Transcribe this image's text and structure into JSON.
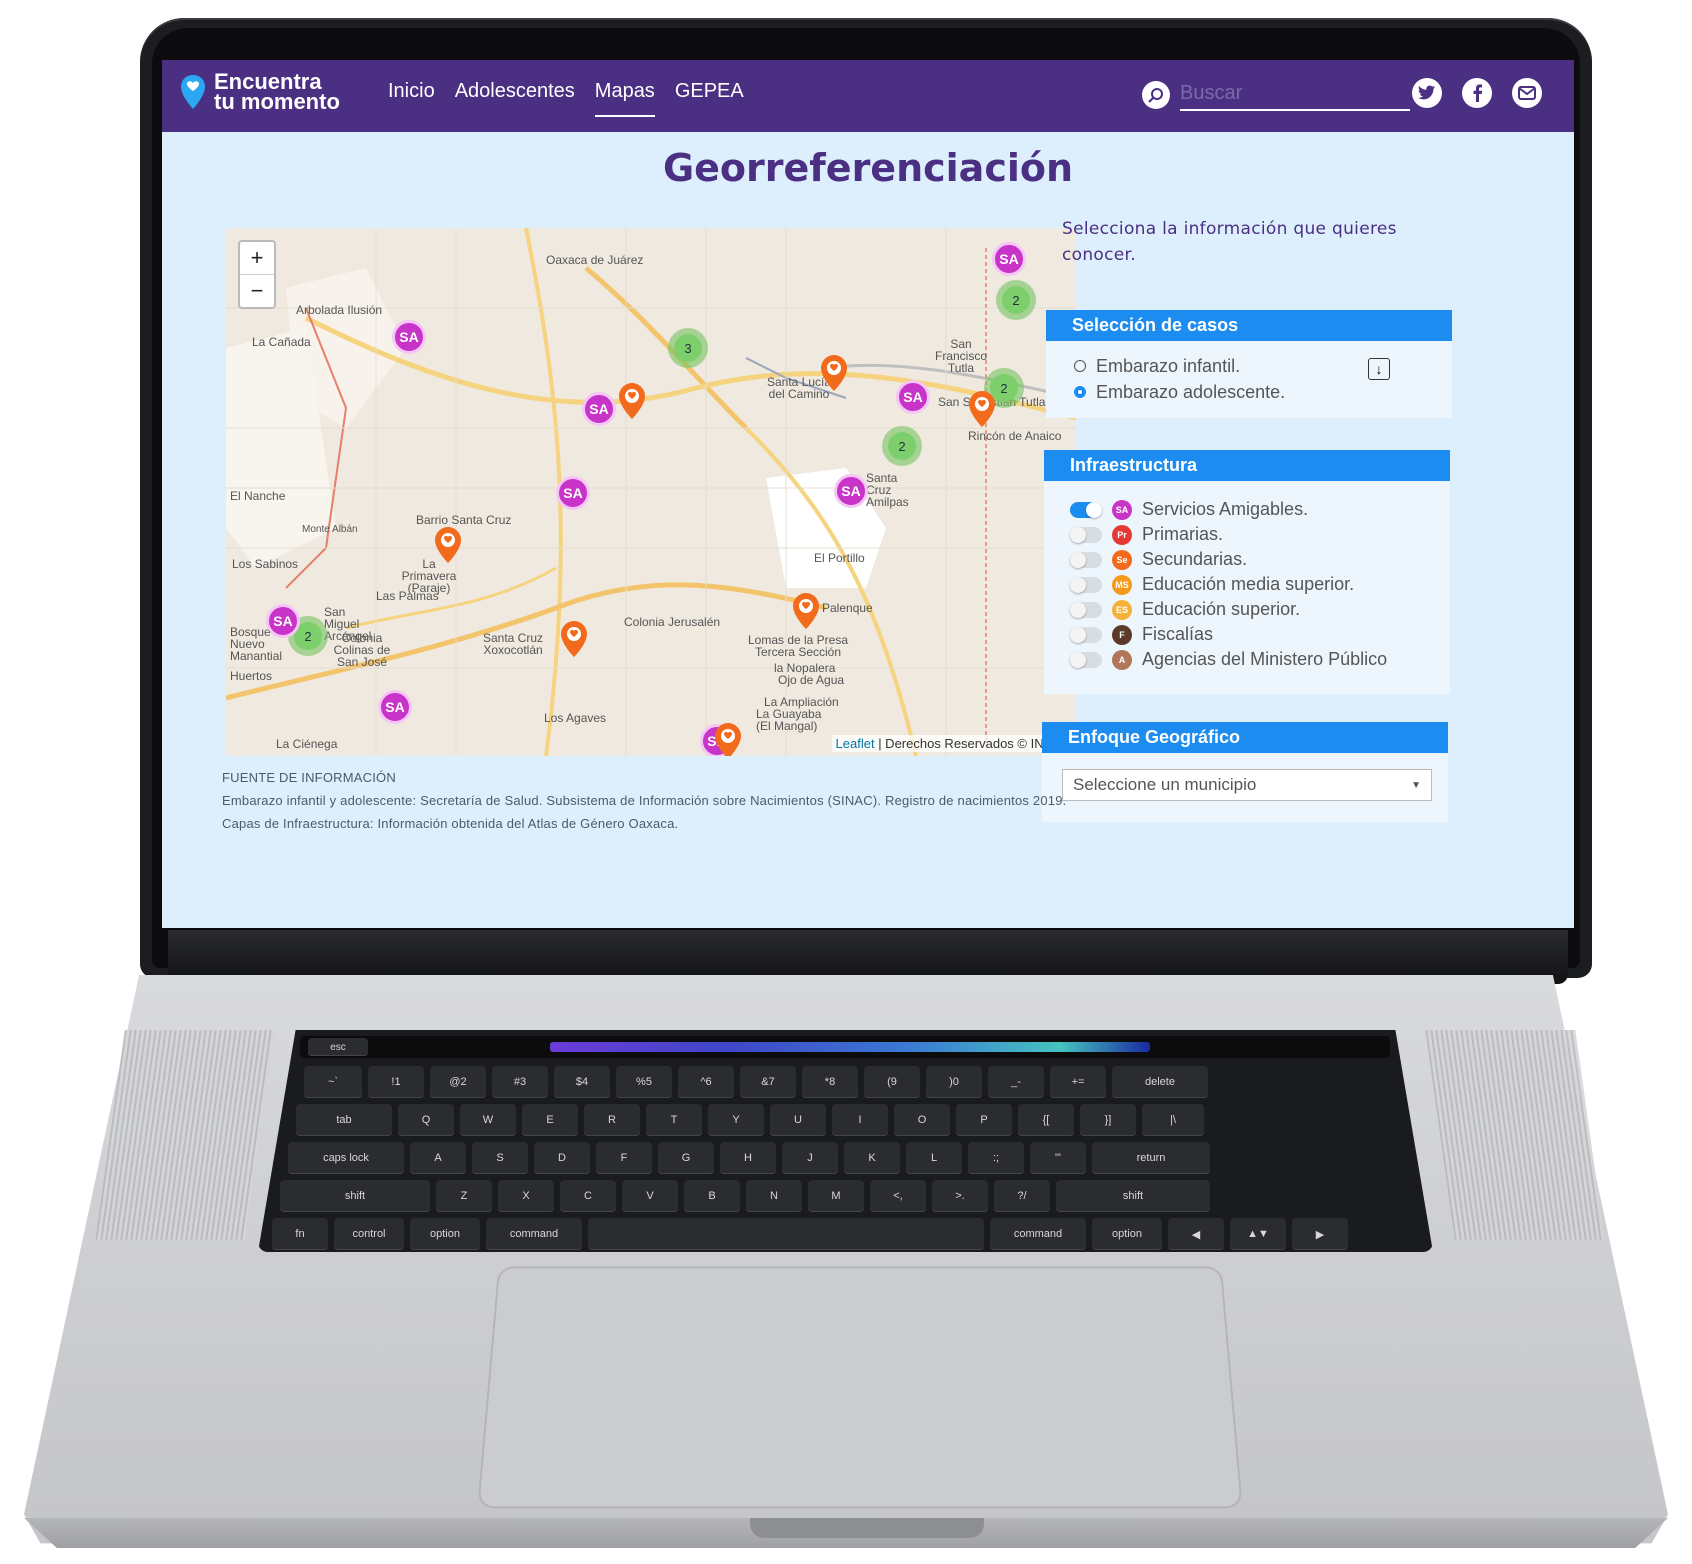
{
  "site": {
    "brand_line1": "Encuentra",
    "brand_line2": "tu momento",
    "nav": [
      "Inicio",
      "Adolescentes",
      "Mapas",
      "GEPEA"
    ],
    "active_nav": "Mapas",
    "search_placeholder": "Buscar",
    "social_icons": [
      "twitter-icon",
      "facebook-icon",
      "mail-icon"
    ]
  },
  "page": {
    "title": "Georreferenciación",
    "prompt": "Selecciona la información que quieres conocer."
  },
  "map": {
    "zoom_in": "+",
    "zoom_out": "−",
    "attribution_link": "Leaflet",
    "attribution_text": " | Derechos Reservados © INEGI",
    "labels": [
      "Oaxaca de Juárez",
      "Arbolada Ilusión",
      "La Cañada",
      "San Francisco Tutla",
      "Santa Lucía del Camino",
      "San Sebastián Tutla",
      "Rincón de Anaico",
      "Santa Cruz Amilpas",
      "Barrio Santa Cruz",
      "Monte Albán",
      "La Primavera (Paraje)",
      "Los Sabinos",
      "Las Palmas",
      "San Miguel Arcángel",
      "Colonia Colinas de San José",
      "Santa Cruz Xoxocotlán",
      "Colonia Jerusalén",
      "El Portillo",
      "El Palenque",
      "Lomas de la Presa Tercera Sección",
      "la Nopalera",
      "Ojo de Agua",
      "La Ampliación",
      "La Guayaba (El Mangal)",
      "Los Agaves",
      "El Nanche",
      "Bosque El Nuevo Manantial",
      "Huertos",
      "La Ciénega"
    ],
    "cluster_counts": [
      3,
      2,
      2,
      2,
      2
    ],
    "sa_marker_label": "SA"
  },
  "panel": {
    "casos": {
      "header": "Selección de casos",
      "options": [
        "Embarazo infantil.",
        "Embarazo adolescente."
      ],
      "selected": "Embarazo adolescente."
    },
    "infra": {
      "header": "Infraestructura",
      "items": [
        {
          "label": "Servicios Amigables.",
          "on": true,
          "icon": "SA",
          "color": "#c833c8"
        },
        {
          "label": "Primarias.",
          "on": false,
          "icon": "Pr",
          "color": "#e53935"
        },
        {
          "label": "Secundarias.",
          "on": false,
          "icon": "Se",
          "color": "#f26b1d"
        },
        {
          "label": "Educación media superior.",
          "on": false,
          "icon": "MS",
          "color": "#f59a1b"
        },
        {
          "label": "Educación superior.",
          "on": false,
          "icon": "ES",
          "color": "#f4b23a"
        },
        {
          "label": "Fiscalías",
          "on": false,
          "icon": "F",
          "color": "#5b3a29"
        },
        {
          "label": "Agencias del Ministero Público",
          "on": false,
          "icon": "A",
          "color": "#b2775a"
        }
      ]
    },
    "geo": {
      "header": "Enfoque Geográfico",
      "select_value": "Seleccione un municipio"
    }
  },
  "source": {
    "heading": "FUENTE DE INFORMACIÓN",
    "line1": "Embarazo infantil y adolescente: Secretaría de Salud. Subsistema de Información sobre Nacimientos (SINAC). Registro de nacimientos 2019.",
    "line2": "Capas de Infraestructura: Información obtenida del Atlas de Género Oaxaca."
  },
  "keyboard": {
    "row1": [
      "~`",
      "!1",
      "@2",
      "#3",
      "$4",
      "%5",
      "^6",
      "&7",
      "*8",
      "(9",
      ")0",
      "_-",
      "+=",
      "delete"
    ],
    "row2": [
      "tab",
      "Q",
      "W",
      "E",
      "R",
      "T",
      "Y",
      "U",
      "I",
      "O",
      "P",
      "{[",
      "}]",
      "|\\"
    ],
    "row3": [
      "caps lock",
      "A",
      "S",
      "D",
      "F",
      "G",
      "H",
      "J",
      "K",
      "L",
      ":;",
      "\"'",
      "return"
    ],
    "row4": [
      "shift",
      "Z",
      "X",
      "C",
      "V",
      "B",
      "N",
      "M",
      "<,",
      ">.",
      "?/",
      "shift"
    ],
    "row5": [
      "fn",
      "control",
      "option",
      "command",
      "",
      "command",
      "option",
      "◀",
      "▲▼",
      "▶"
    ],
    "touchbar_esc": "esc"
  },
  "colors": {
    "nav": "#4b2f82",
    "accent": "#1d8cf0",
    "screen_bg": "#ddeffc",
    "sa_marker": "#c833c8",
    "pin": "#f26b1d",
    "cluster": "#7ccf6a"
  }
}
